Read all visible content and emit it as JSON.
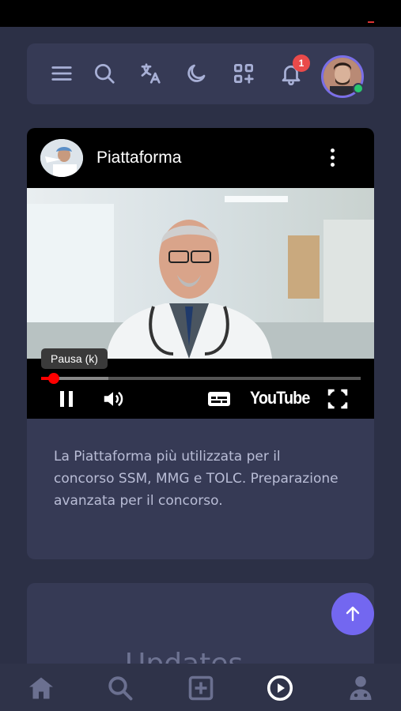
{
  "topbar": {
    "icons": [
      "menu-icon",
      "search-icon",
      "translate-icon",
      "moon-icon",
      "apps-add-icon",
      "bell-icon"
    ],
    "notification_count": "1"
  },
  "video": {
    "channel_title": "Piattaforma",
    "tooltip": "Pausa (k)",
    "youtube_label": "YouTube",
    "progress": {
      "played": 0.04,
      "loaded": 0.21
    }
  },
  "description": "La Piattaforma più utilizzata per il concorso SSM, MMG e TOLC. Preparazione avanzata per il concorso.",
  "card2": {
    "title": "Updates"
  },
  "bottom_nav": [
    "home-icon",
    "search-icon",
    "add-box-icon",
    "play-circle-icon",
    "doctor-icon"
  ],
  "colors": {
    "accent": "#7367f0",
    "badge": "#ea4a4a",
    "background": "#2c3046",
    "card": "#363a55"
  }
}
